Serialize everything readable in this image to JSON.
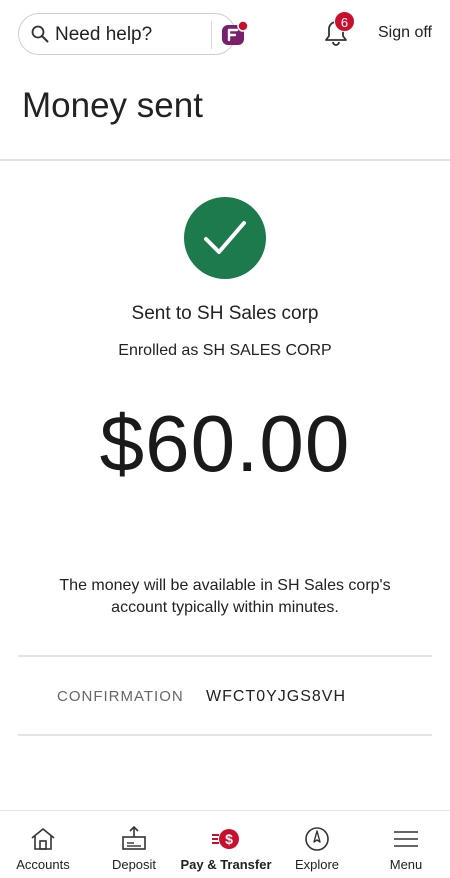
{
  "header": {
    "help_label": "Need help?",
    "notification_count": "6",
    "signoff_label": "Sign off"
  },
  "page": {
    "title": "Money sent"
  },
  "result": {
    "sent_to": "Sent to SH Sales corp",
    "enrolled_as": "Enrolled as SH SALES CORP",
    "amount": "$60.00",
    "message": "The money will be available in SH Sales corp's account typically within minutes.",
    "confirmation_label": "CONFIRMATION",
    "confirmation_value": "WFCT0YJGS8VH"
  },
  "nav": {
    "items": [
      {
        "label": "Accounts",
        "icon": "home-icon"
      },
      {
        "label": "Deposit",
        "icon": "deposit-icon"
      },
      {
        "label": "Pay & Transfer",
        "icon": "pay-transfer-icon",
        "active": true
      },
      {
        "label": "Explore",
        "icon": "compass-icon"
      },
      {
        "label": "Menu",
        "icon": "hamburger-menu-icon"
      }
    ]
  },
  "colors": {
    "success_green": "#1c7a4d",
    "brand_red": "#c8102e",
    "assistant_purple": "#7a1f6e"
  }
}
